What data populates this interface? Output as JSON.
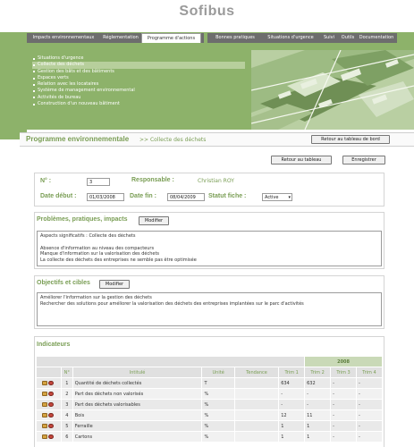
{
  "app": {
    "logo_text": "Sofibus"
  },
  "nav_left": [
    {
      "label": "Impacts environnementaux"
    },
    {
      "label": "Réglementation"
    },
    {
      "label": "Programme d'actions"
    }
  ],
  "nav_right": [
    {
      "label": "Bonnes pratiques"
    },
    {
      "label": "Situations d'urgence"
    },
    {
      "label": "Suivi"
    },
    {
      "label": "Outils"
    },
    {
      "label": "Documentation"
    }
  ],
  "side_menu": [
    {
      "label": "Situations d'urgence"
    },
    {
      "label": "Collecte des déchets"
    },
    {
      "label": "Gestion des bâts et des bâtiments"
    },
    {
      "label": "Espaces verts"
    },
    {
      "label": "Relation avec les locataires"
    },
    {
      "label": "Système de management environnemental"
    },
    {
      "label": "Activités de bureau"
    },
    {
      "label": "Construction d'un nouveau bâtiment"
    }
  ],
  "page": {
    "title": "Programme environnementale",
    "subtitle": ">> Collecte des déchets",
    "back_to_board": "Retour au tableau de bord",
    "back_to_table": "Retour au tableau",
    "save": "Enregistrer"
  },
  "fiche": {
    "num_label": "N° :",
    "num_value": "3",
    "responsable_label": "Responsable :",
    "responsable_value": "Christian ROY",
    "date_debut_label": "Date début :",
    "date_debut_value": "01/03/2008",
    "date_fin_label": "Date fin :",
    "date_fin_value": "08/04/2009",
    "statut_label": "Statut fiche :",
    "statut_value": "Active"
  },
  "problemes": {
    "title": "Problèmes, pratiques, impacts",
    "modify": "Modifier",
    "text": "Aspects significatifs : Collecte des déchets\n\nAbsence d'information au niveau des compacteurs\nManque d'information sur la valorisation des déchets\nLa collecte des déchets des entreprises ne semble pas être optimisée"
  },
  "objectifs": {
    "title": "Objectifs et cibles",
    "modify": "Modifier",
    "text": "Améliorer l'information sur la gestion des déchets\nRechercher des solutions pour améliorer la valorisation des déchets des entreprises implantées sur le parc d'activités"
  },
  "indicateurs": {
    "title": "Indicateurs",
    "year": "2008",
    "headers": [
      "N°",
      "Intitulé",
      "Unité",
      "Tendance",
      "Trim 1",
      "Trim 2",
      "Trim 3",
      "Trim 4"
    ],
    "rows": [
      {
        "n": "1",
        "intitule": "Quantité de déchets collectés",
        "unite": "T",
        "tendance": "",
        "t1": "634",
        "t2": "632",
        "t3": "-",
        "t4": "-"
      },
      {
        "n": "2",
        "intitule": "Part des déchets non valorisés",
        "unite": "%",
        "tendance": "",
        "t1": "-",
        "t2": "-",
        "t3": "-",
        "t4": "-"
      },
      {
        "n": "3",
        "intitule": "Part des déchets valorisables",
        "unite": "%",
        "tendance": "",
        "t1": "-",
        "t2": "-",
        "t3": "-",
        "t4": "-"
      },
      {
        "n": "4",
        "intitule": "Bois",
        "unite": "%",
        "tendance": "",
        "t1": "12",
        "t2": "11",
        "t3": "-",
        "t4": "-"
      },
      {
        "n": "5",
        "intitule": "Ferraille",
        "unite": "%",
        "tendance": "",
        "t1": "1",
        "t2": "1",
        "t3": "-",
        "t4": "-"
      },
      {
        "n": "6",
        "intitule": "Cartons",
        "unite": "%",
        "tendance": "",
        "t1": "1",
        "t2": "1",
        "t3": "-",
        "t4": "-"
      }
    ]
  },
  "colors": {
    "accent": "#7a9e55",
    "band": "#8db26a",
    "nav_bg": "#6d6d6d"
  }
}
